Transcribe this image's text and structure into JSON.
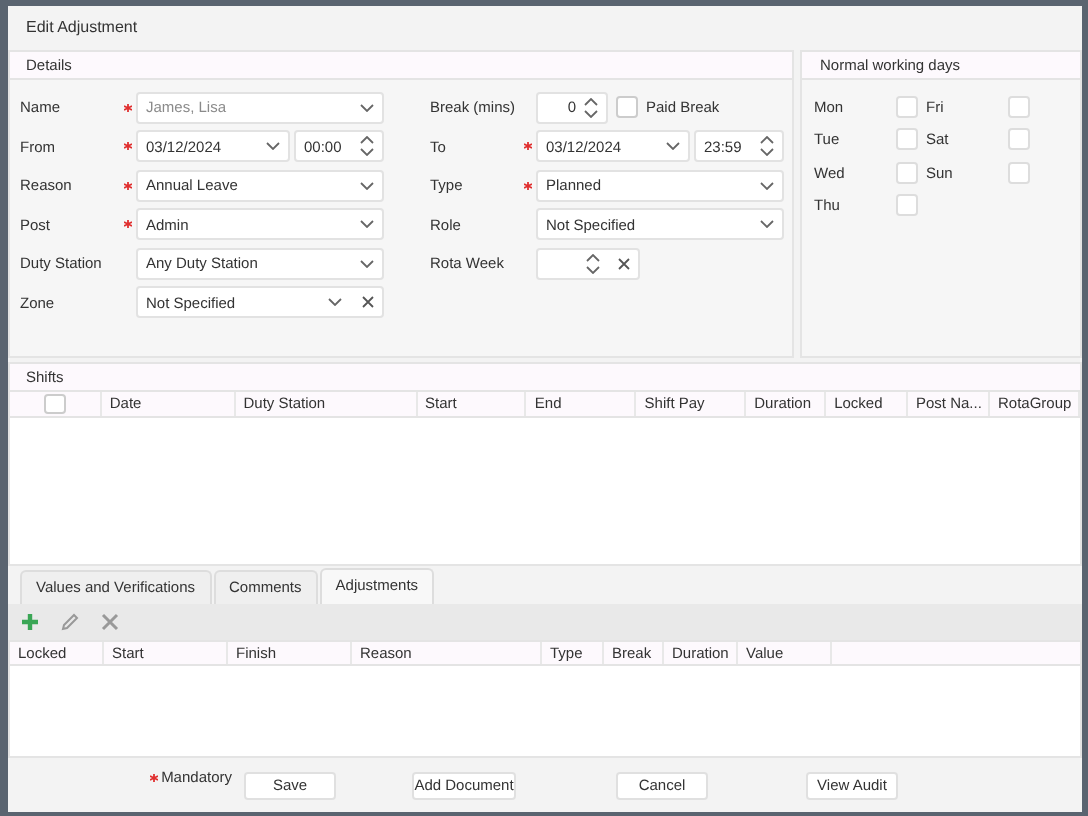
{
  "window": {
    "title": "Edit Adjustment"
  },
  "details": {
    "title": "Details",
    "left_fields": [
      {
        "label": "Name",
        "required": true,
        "kind": "dropdown",
        "value": "James, Lisa",
        "disabled": true
      },
      {
        "label": "From",
        "required": true,
        "kind": "datetime",
        "value": "03/12/2024",
        "time": "00:00"
      },
      {
        "label": "Reason",
        "required": true,
        "kind": "dropdown",
        "value": "Annual Leave"
      },
      {
        "label": "Post",
        "required": true,
        "kind": "dropdown",
        "value": "Admin"
      },
      {
        "label": "Duty Station",
        "required": false,
        "kind": "dropdown",
        "value": "Any Duty Station"
      },
      {
        "label": "Zone",
        "required": false,
        "kind": "dropdown_clear",
        "value": "Not Specified"
      }
    ],
    "right_fields": [
      {
        "label": "Break (mins)",
        "required": false,
        "kind": "spin_check",
        "value": "0",
        "check_label": "Paid Break",
        "checked": false
      },
      {
        "label": "To",
        "required": true,
        "kind": "datetime",
        "value": "03/12/2024",
        "time": "23:59"
      },
      {
        "label": "Type",
        "required": true,
        "kind": "dropdown",
        "value": "Planned"
      },
      {
        "label": "Role",
        "required": false,
        "kind": "dropdown",
        "value": "Not Specified"
      },
      {
        "label": "Rota Week",
        "required": false,
        "kind": "spin_clear"
      }
    ]
  },
  "working_days": {
    "title": "Normal working days",
    "days": [
      {
        "label": "Mon",
        "checked": false
      },
      {
        "label": "Tue",
        "checked": false
      },
      {
        "label": "Wed",
        "checked": false
      },
      {
        "label": "Thu",
        "checked": false
      },
      {
        "label": "Fri",
        "checked": false
      },
      {
        "label": "Sat",
        "checked": false
      },
      {
        "label": "Sun",
        "checked": false
      }
    ]
  },
  "shifts": {
    "title": "Shifts",
    "select_all_checked": false,
    "columns": [
      "Date",
      "Duty Station",
      "Start",
      "End",
      "Shift Pay",
      "Duration",
      "Locked",
      "Post Na...",
      "RotaGroup"
    ]
  },
  "tabs": [
    {
      "label": "Values and Verifications",
      "selected": false
    },
    {
      "label": "Comments",
      "selected": false
    },
    {
      "label": "Adjustments",
      "selected": true
    }
  ],
  "toolbar": [
    {
      "kind": "add",
      "disabled": false
    },
    {
      "kind": "edit",
      "disabled": true
    },
    {
      "kind": "delete",
      "disabled": true
    }
  ],
  "adjustments": {
    "columns": [
      "Locked",
      "Start",
      "Finish",
      "Reason",
      "Type",
      "Break",
      "Duration",
      "Value"
    ]
  },
  "footer": {
    "mandatory_note": "Mandatory",
    "buttons": [
      "Save",
      "Add Document",
      "Cancel",
      "View Audit"
    ]
  }
}
